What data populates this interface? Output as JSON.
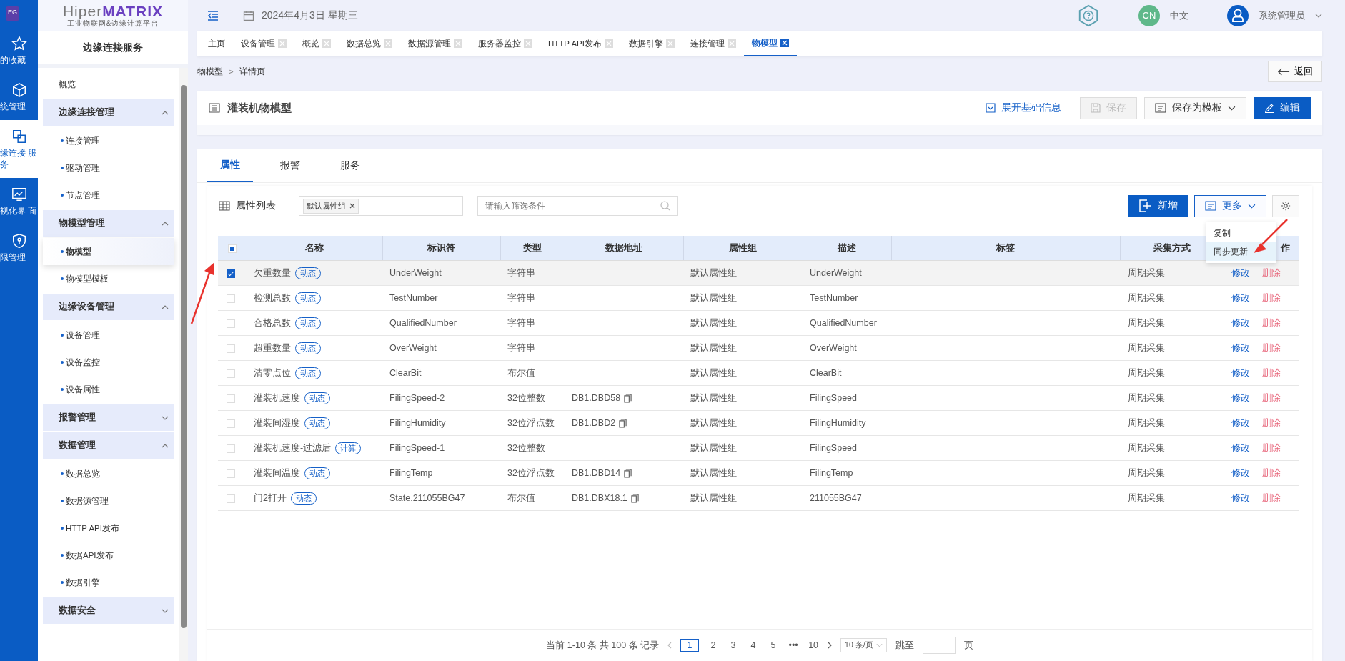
{
  "logo": {
    "badge": "EG",
    "name_light": "Hiper",
    "name_bold": "MATRIX",
    "subtitle": "工业物联网&边缘计算平台"
  },
  "rail": [
    {
      "label": "的收藏",
      "selected": false
    },
    {
      "label": "统管理",
      "selected": false
    },
    {
      "label": "缘连接 服务",
      "selected": true
    },
    {
      "label": "视化界 面",
      "selected": false
    },
    {
      "label": "限管理",
      "selected": false
    }
  ],
  "sidebar": {
    "title": "边缘连接服务",
    "items": [
      {
        "kind": "link",
        "label": "概览"
      },
      {
        "kind": "group",
        "label": "边缘连接管理",
        "expanded": true,
        "children": [
          {
            "label": "连接管理",
            "selected": false
          },
          {
            "label": "驱动管理",
            "selected": false
          },
          {
            "label": "节点管理",
            "selected": false
          }
        ]
      },
      {
        "kind": "group",
        "label": "物模型管理",
        "expanded": true,
        "children": [
          {
            "label": "物模型",
            "selected": true
          },
          {
            "label": "物模型模板",
            "selected": false
          }
        ]
      },
      {
        "kind": "group",
        "label": "边缘设备管理",
        "expanded": true,
        "children": [
          {
            "label": "设备管理",
            "selected": false
          },
          {
            "label": "设备监控",
            "selected": false
          },
          {
            "label": "设备属性",
            "selected": false
          }
        ]
      },
      {
        "kind": "group",
        "label": "报警管理",
        "expanded": false
      },
      {
        "kind": "group",
        "label": "数据管理",
        "expanded": true,
        "children": [
          {
            "label": "数据总览",
            "selected": false
          },
          {
            "label": "数据源管理",
            "selected": false
          },
          {
            "label": "HTTP API发布",
            "selected": false
          },
          {
            "label": "数据API发布",
            "selected": false
          },
          {
            "label": "数据引擎",
            "selected": false
          }
        ]
      },
      {
        "kind": "group",
        "label": "数据安全",
        "expanded": false
      }
    ]
  },
  "topbar": {
    "date": "2024年4月3日 星期三",
    "lang_badge": "CN",
    "lang": "中文",
    "user": "系统管理员"
  },
  "tabs": [
    {
      "label": "主页",
      "closable": false,
      "selected": false
    },
    {
      "label": "设备管理",
      "closable": true,
      "selected": false
    },
    {
      "label": "概览",
      "closable": true,
      "selected": false
    },
    {
      "label": "数据总览",
      "closable": true,
      "selected": false
    },
    {
      "label": "数据源管理",
      "closable": true,
      "selected": false
    },
    {
      "label": "服务器监控",
      "closable": true,
      "selected": false
    },
    {
      "label": "HTTP API发布",
      "closable": true,
      "selected": false
    },
    {
      "label": "数据引擎",
      "closable": true,
      "selected": false
    },
    {
      "label": "连接管理",
      "closable": true,
      "selected": false
    },
    {
      "label": "物模型",
      "closable": true,
      "selected": true
    }
  ],
  "breadcrumb": [
    "物模型",
    "详情页"
  ],
  "breadcrumb_separator": ">",
  "back": "返回",
  "header": {
    "title": "灌装机物模型",
    "expand": "展开基础信息",
    "save": "保存",
    "save_disabled": true,
    "template": "保存为模板",
    "edit": "编辑"
  },
  "detail_tabs": [
    {
      "label": "属性",
      "selected": true
    },
    {
      "label": "报警",
      "selected": false
    },
    {
      "label": "服务",
      "selected": false
    }
  ],
  "list": {
    "title": "属性列表",
    "group_tag": "默认属性组",
    "search_placeholder": "请输入筛选条件",
    "add": "新增",
    "more": "更多",
    "more_menu": [
      {
        "label": "复制",
        "selected": false
      },
      {
        "label": "同步更新",
        "selected": true
      }
    ]
  },
  "table": {
    "select_all_indeterminate": true,
    "columns": [
      "名称",
      "标识符",
      "类型",
      "数据地址",
      "属性组",
      "描述",
      "标签",
      "采集方式",
      "作"
    ],
    "rows": [
      {
        "checked": true,
        "name": "欠重数量",
        "tag": "动态",
        "id": "UnderWeight",
        "type": "字符串",
        "address": "",
        "group": "默认属性组",
        "desc": "UnderWeight",
        "collect": "周期采集",
        "edit": "修改",
        "delete": "删除"
      },
      {
        "checked": false,
        "name": "检测总数",
        "tag": "动态",
        "id": "TestNumber",
        "type": "字符串",
        "address": "",
        "group": "默认属性组",
        "desc": "TestNumber",
        "collect": "周期采集",
        "edit": "修改",
        "delete": "删除"
      },
      {
        "checked": false,
        "name": "合格总数",
        "tag": "动态",
        "id": "QualifiedNumber",
        "type": "字符串",
        "address": "",
        "group": "默认属性组",
        "desc": "QualifiedNumber",
        "collect": "周期采集",
        "edit": "修改",
        "delete": "删除"
      },
      {
        "checked": false,
        "name": "超重数量",
        "tag": "动态",
        "id": "OverWeight",
        "type": "字符串",
        "address": "",
        "group": "默认属性组",
        "desc": "OverWeight",
        "collect": "周期采集",
        "edit": "修改",
        "delete": "删除"
      },
      {
        "checked": false,
        "name": "清零点位",
        "tag": "动态",
        "id": "ClearBit",
        "type": "布尔值",
        "address": "",
        "group": "默认属性组",
        "desc": "ClearBit",
        "collect": "周期采集",
        "edit": "修改",
        "delete": "删除"
      },
      {
        "checked": false,
        "name": "灌装机速度",
        "tag": "动态",
        "id": "FilingSpeed-2",
        "type": "32位整数",
        "address": "DB1.DBD58",
        "group": "默认属性组",
        "desc": "FilingSpeed",
        "collect": "周期采集",
        "edit": "修改",
        "delete": "删除"
      },
      {
        "checked": false,
        "name": "灌装间湿度",
        "tag": "动态",
        "id": "FilingHumidity",
        "type": "32位浮点数",
        "address": "DB1.DBD2",
        "group": "默认属性组",
        "desc": "FilingHumidity",
        "collect": "周期采集",
        "edit": "修改",
        "delete": "删除"
      },
      {
        "checked": false,
        "name": "灌装机速度-过滤后",
        "tag": "计算",
        "id": "FilingSpeed-1",
        "type": "32位整数",
        "address": "",
        "group": "默认属性组",
        "desc": "FilingSpeed",
        "collect": "周期采集",
        "edit": "修改",
        "delete": "删除"
      },
      {
        "checked": false,
        "name": "灌装间温度",
        "tag": "动态",
        "id": "FilingTemp",
        "type": "32位浮点数",
        "address": "DB1.DBD14",
        "group": "默认属性组",
        "desc": "FilingTemp",
        "collect": "周期采集",
        "edit": "修改",
        "delete": "删除"
      },
      {
        "checked": false,
        "name": "门2打开",
        "tag": "动态",
        "id": "State.211055BG47",
        "type": "布尔值",
        "address": "DB1.DBX18.1",
        "group": "默认属性组",
        "desc": "211055BG47",
        "collect": "周期采集",
        "edit": "修改",
        "delete": "删除"
      }
    ]
  },
  "pagination": {
    "summary": "当前 1-10 条 共 100 条 记录",
    "pages": [
      {
        "label": "1",
        "selected": true
      },
      {
        "label": "2",
        "selected": false
      },
      {
        "label": "3",
        "selected": false
      },
      {
        "label": "4",
        "selected": false
      },
      {
        "label": "5",
        "selected": false
      },
      {
        "label": "•••",
        "selected": false
      },
      {
        "label": "10",
        "selected": false
      }
    ],
    "page_size": "10 条/页",
    "jump": "跳至",
    "unit": "页"
  }
}
